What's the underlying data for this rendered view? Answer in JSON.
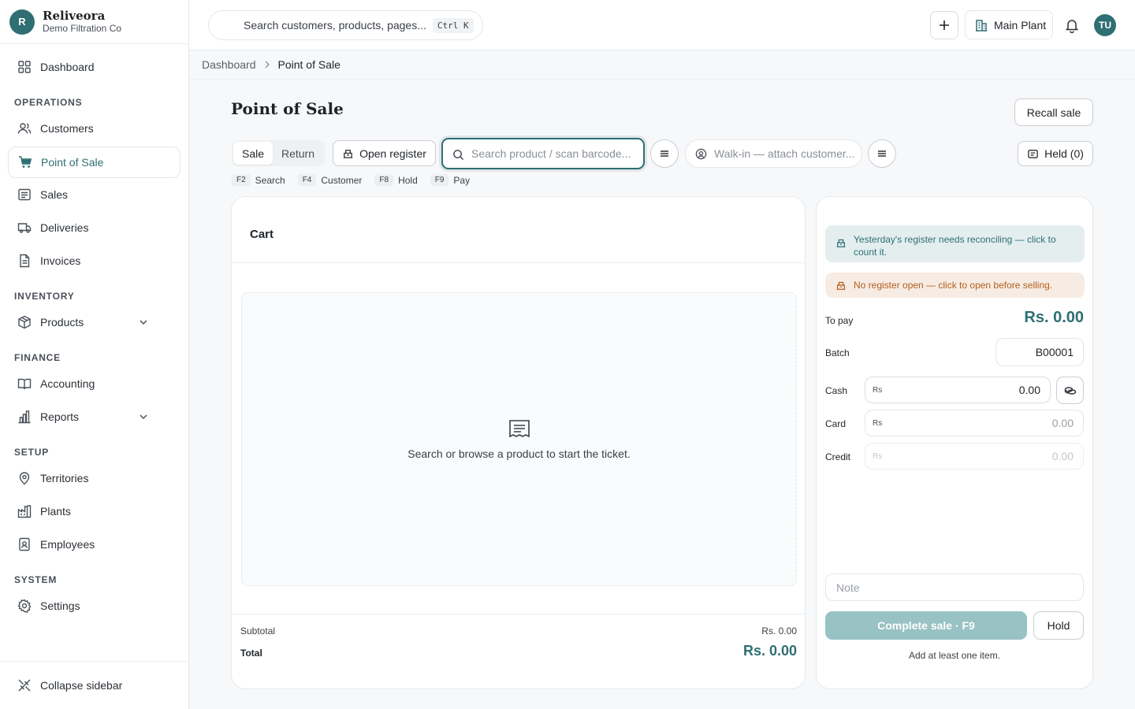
{
  "brand": {
    "initial": "R",
    "name": "Reliveora",
    "org": "Demo Filtration Co"
  },
  "sidebar": {
    "dashboard": "Dashboard",
    "sections": {
      "operations": "OPERATIONS",
      "inventory": "INVENTORY",
      "finance": "FINANCE",
      "setup": "SETUP",
      "system": "SYSTEM"
    },
    "items": {
      "customers": "Customers",
      "pos": "Point of Sale",
      "sales": "Sales",
      "deliveries": "Deliveries",
      "invoices": "Invoices",
      "products": "Products",
      "accounting": "Accounting",
      "reports": "Reports",
      "territories": "Territories",
      "plants": "Plants",
      "employees": "Employees",
      "settings": "Settings"
    },
    "collapse": "Collapse sidebar",
    "active_item": "Point of Sale"
  },
  "topbar": {
    "search_placeholder": "Search customers, products, pages...",
    "search_shortcut": "Ctrl K",
    "plant": "Main Plant",
    "user_initials": "TU"
  },
  "breadcrumb": {
    "root": "Dashboard",
    "current": "Point of Sale"
  },
  "page": {
    "title": "Point of Sale",
    "recall_label": "Recall sale",
    "mode_tabs": [
      "Sale",
      "Return"
    ],
    "active_mode": "Sale",
    "open_register_label": "Open register",
    "product_search_placeholder": "Search product / scan barcode...",
    "customer_placeholder": "Walk-in — attach customer...",
    "held_label": "Held (0)",
    "shortcuts": [
      {
        "key": "F2",
        "label": "Search"
      },
      {
        "key": "F4",
        "label": "Customer"
      },
      {
        "key": "F8",
        "label": "Hold"
      },
      {
        "key": "F9",
        "label": "Pay"
      }
    ]
  },
  "cart": {
    "title": "Cart",
    "empty_message": "Search or browse a product to start the ticket.",
    "subtotal_label": "Subtotal",
    "subtotal_value": "Rs. 0.00",
    "total_label": "Total",
    "total_value": "Rs. 0.00"
  },
  "payment": {
    "reconcile_alert": "Yesterday's register needs reconciling — click to count it.",
    "no_register_alert": "No register open — click to open before selling.",
    "to_pay_label": "To pay",
    "to_pay_value": "Rs. 0.00",
    "batch_label": "Batch",
    "batch_value": "B00001",
    "currency_symbol": "Rs",
    "cash_label": "Cash",
    "cash_value": "0.00",
    "card_label": "Card",
    "card_value": "0.00",
    "credit_label": "Credit",
    "credit_value": "0.00",
    "note_placeholder": "Note",
    "complete_label": "Complete sale · F9",
    "hold_label": "Hold",
    "hint": "Add at least one item."
  },
  "colors": {
    "accent": "#2f6f73",
    "accent_disabled": "#98c2c3",
    "warn": "#b35e1c",
    "info_bg": "#e4eeee",
    "warn_bg": "#f7ece3"
  }
}
